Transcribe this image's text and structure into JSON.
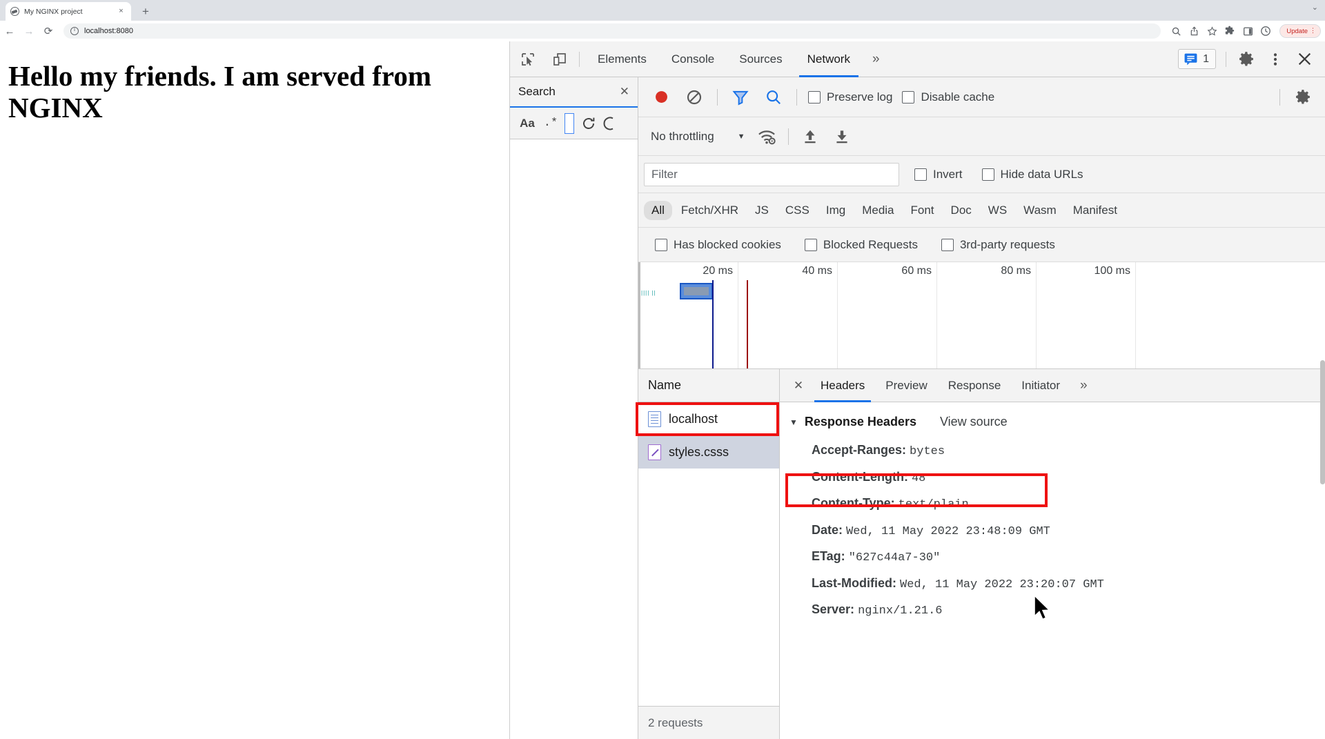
{
  "browser": {
    "tab": {
      "title": "My NGINX project",
      "favicon": "globe-icon",
      "close": "×"
    },
    "new_tab": "+",
    "tabstrip_chevron": "⌄",
    "nav": {
      "back": "←",
      "forward": "→",
      "reload": "⟳"
    },
    "omnibox": {
      "url": "localhost:8080",
      "info_icon": "info-circle-icon"
    },
    "toolbar_icons": [
      "search-icon",
      "share-icon",
      "bookmark-star-icon",
      "extensions-puzzle-icon",
      "side-panel-icon",
      "history-clock-icon"
    ],
    "update_button": {
      "label": "Update",
      "menu": "⋮"
    }
  },
  "page": {
    "heading": "Hello my friends. I am served from NGINX"
  },
  "devtools": {
    "header": {
      "inspect_icon": "inspect-element-icon",
      "device_icon": "device-toolbar-icon",
      "tabs": [
        {
          "label": "Elements",
          "active": false
        },
        {
          "label": "Console",
          "active": false
        },
        {
          "label": "Sources",
          "active": false
        },
        {
          "label": "Network",
          "active": true
        }
      ],
      "more_tabs": "»",
      "issues_badge": {
        "icon": "message-badge-icon",
        "count": "1"
      },
      "settings_icon": "gear-icon",
      "menu_icon": "dots-vertical-icon",
      "close_icon": "close-icon"
    },
    "search_pane": {
      "title": "Search",
      "close": "✕",
      "match_case": "Aa",
      "regex": ".*",
      "input_value": "",
      "refresh_icon": "refresh-icon",
      "clear_icon": "clear-icon"
    },
    "network": {
      "toolbar": {
        "record_icon": "record-circle-icon",
        "clear_icon": "clear-network-icon",
        "filter_icon": "filter-funnel-icon",
        "search_icon": "search-icon",
        "preserve_log": "Preserve log",
        "disable_cache": "Disable cache",
        "settings_icon": "gear-icon"
      },
      "throttling": {
        "value": "No throttling",
        "caret": "▼",
        "wifi_icon": "wifi-settings-icon",
        "upload_icon": "upload-icon",
        "download_icon": "download-icon"
      },
      "filter": {
        "placeholder": "Filter",
        "value": "",
        "invert": "Invert",
        "hide_data_urls": "Hide data URLs"
      },
      "types": [
        {
          "label": "All",
          "active": true
        },
        {
          "label": "Fetch/XHR",
          "active": false
        },
        {
          "label": "JS",
          "active": false
        },
        {
          "label": "CSS",
          "active": false
        },
        {
          "label": "Img",
          "active": false
        },
        {
          "label": "Media",
          "active": false
        },
        {
          "label": "Font",
          "active": false
        },
        {
          "label": "Doc",
          "active": false
        },
        {
          "label": "WS",
          "active": false
        },
        {
          "label": "Wasm",
          "active": false
        },
        {
          "label": "Manifest",
          "active": false
        }
      ],
      "flags": [
        {
          "label": "Has blocked cookies"
        },
        {
          "label": "Blocked Requests"
        },
        {
          "label": "3rd-party requests"
        }
      ],
      "overview": {
        "ticks": [
          "20 ms",
          "40 ms",
          "60 ms",
          "80 ms",
          "100 ms"
        ],
        "tiny_label": "|||| ||"
      },
      "request_list": {
        "column_name": "Name",
        "rows": [
          {
            "name": "localhost",
            "icon": "document-icon",
            "selected": false
          },
          {
            "name": "styles.csss",
            "icon": "stylesheet-icon",
            "selected": true
          }
        ],
        "footer": "2 requests"
      },
      "detail": {
        "close": "✕",
        "tabs": [
          {
            "label": "Headers",
            "active": true
          },
          {
            "label": "Preview",
            "active": false
          },
          {
            "label": "Response",
            "active": false
          },
          {
            "label": "Initiator",
            "active": false
          }
        ],
        "more_tabs": "»",
        "section": {
          "caret": "▼",
          "title": "Response Headers",
          "view_source": "View source"
        },
        "headers": [
          {
            "key": "Accept-Ranges:",
            "value": "bytes"
          },
          {
            "key": "Content-Length:",
            "value": "48"
          },
          {
            "key": "Content-Type:",
            "value": "text/plain"
          },
          {
            "key": "Date:",
            "value": "Wed, 11 May 2022 23:48:09 GMT"
          },
          {
            "key": "ETag:",
            "value": "\"627c44a7-30\""
          },
          {
            "key": "Last-Modified:",
            "value": "Wed, 11 May 2022 23:20:07 GMT"
          },
          {
            "key": "Server:",
            "value": "nginx/1.21.6"
          }
        ]
      }
    }
  },
  "annotations": {
    "color": "#ee1111",
    "boxes": [
      "styles-css-row-highlight",
      "content-type-header-highlight"
    ]
  }
}
